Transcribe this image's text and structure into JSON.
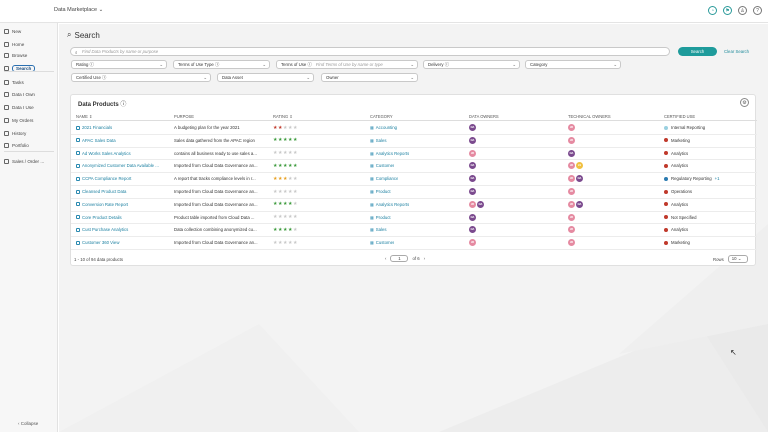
{
  "app": {
    "title": "Data Marketplace",
    "title_chevron": "⌄"
  },
  "topbar_icons": [
    {
      "name": "notification-icon",
      "glyph": "◔"
    },
    {
      "name": "flag-icon",
      "glyph": "⚑"
    },
    {
      "name": "user-icon",
      "glyph": "♙"
    },
    {
      "name": "help-icon",
      "glyph": "?"
    }
  ],
  "sidebar": {
    "items": [
      {
        "label": "New",
        "icon": "new-icon"
      },
      {
        "label": "Home",
        "icon": "home-icon"
      },
      {
        "label": "Browse",
        "icon": "browse-icon"
      },
      {
        "label": "Search",
        "icon": "search-icon",
        "active": true
      },
      {
        "label": "Tasks",
        "icon": "tasks-icon"
      },
      {
        "label": "Data I Own",
        "icon": "data-own-icon"
      },
      {
        "label": "Data I Use",
        "icon": "data-use-icon"
      },
      {
        "label": "My Orders",
        "icon": "orders-icon"
      },
      {
        "label": "History",
        "icon": "history-icon"
      },
      {
        "label": "Portfolio",
        "icon": "portfolio-icon"
      },
      {
        "label": "Sales / Order ...",
        "icon": "sales-icon"
      }
    ],
    "collapse_label": "Collapse"
  },
  "page": {
    "title": "Search"
  },
  "search": {
    "placeholder": "Find Data Products by name or purpose",
    "button_label": "Search",
    "clear_label": "Clear Search"
  },
  "filters": {
    "rating": "Rating",
    "terms_type": "Terms of Use Type",
    "terms_of_use": "Terms of Use",
    "terms_placeholder": "Find Terms of Use by name or type",
    "delivery": "Delivery",
    "category": "Category",
    "certified_use": "Certified Use",
    "data_asset": "Data Asset",
    "owner": "Owner"
  },
  "table": {
    "title": "Data Products",
    "columns": {
      "name": "NAME",
      "purpose": "PURPOSE",
      "rating": "RATING",
      "category": "CATEGORY",
      "data_owners": "DATA OWNERS",
      "technical_owners": "TECHNICAL OWNERS",
      "certified_use": "CERTIFIED USE"
    },
    "rows": [
      {
        "name": "2021 Financials",
        "purpose": "A budgeting plan for the year 2021",
        "rating": 2,
        "star_color": "#c0392b",
        "category": "Accounting",
        "owners": [
          {
            "i": "NA",
            "c": "#7b4a8e"
          }
        ],
        "tech": [
          {
            "i": "JR",
            "c": "#e58aa1"
          }
        ],
        "use": "Internal Reporting",
        "use_color": "#9ad0e0"
      },
      {
        "name": "APAC Sales Data",
        "purpose": "Sales data gathered from the APAC region",
        "rating": 5,
        "star_color": "#3c9a3c",
        "category": "Sales",
        "owners": [
          {
            "i": "NA",
            "c": "#7b4a8e"
          }
        ],
        "tech": [
          {
            "i": "JR",
            "c": "#e58aa1"
          }
        ],
        "use": "Marketing",
        "use_color": "#c0392b"
      },
      {
        "name": "Ad Works Sales Analytics",
        "purpose": "contains all business ready to use sales a...",
        "rating": 0,
        "star_color": "#c8c8c8",
        "category": "Analytics Reports",
        "owners": [
          {
            "i": "JR",
            "c": "#e58aa1"
          }
        ],
        "tech": [
          {
            "i": "NA",
            "c": "#7b4a8e"
          }
        ],
        "use": "Analytics",
        "use_color": "#c0392b"
      },
      {
        "name": "Anonymized Customer Data Available ...",
        "purpose": "Imported from Cloud Data Governance an...",
        "rating": 5,
        "star_color": "#3c9a3c",
        "category": "Customer",
        "owners": [
          {
            "i": "NA",
            "c": "#7b4a8e"
          }
        ],
        "tech": [
          {
            "i": "JR",
            "c": "#e58aa1"
          },
          {
            "i": "LS",
            "c": "#f0c040"
          }
        ],
        "use": "Analytics",
        "use_color": "#c0392b"
      },
      {
        "name": "CCPA Compliance Report",
        "purpose": "A report that tracks compliance levels in r...",
        "rating": 3,
        "star_color": "#e8a020",
        "category": "Compliance",
        "owners": [
          {
            "i": "NA",
            "c": "#7b4a8e"
          }
        ],
        "tech": [
          {
            "i": "JR",
            "c": "#e58aa1"
          },
          {
            "i": "NA",
            "c": "#7b4a8e"
          }
        ],
        "use": "Regulatory Reporting",
        "use_color": "#2a7ab0",
        "use_extra": "+1"
      },
      {
        "name": "Cleansed Product Data",
        "purpose": "Imported from Cloud Data Governance an...",
        "rating": 0,
        "star_color": "#c8c8c8",
        "category": "Product",
        "owners": [
          {
            "i": "NA",
            "c": "#7b4a8e"
          }
        ],
        "tech": [
          {
            "i": "JR",
            "c": "#e58aa1"
          }
        ],
        "use": "Operations",
        "use_color": "#c0392b"
      },
      {
        "name": "Conversion Rate Report",
        "purpose": "Imported from Cloud Data Governance an...",
        "rating": 4,
        "star_color": "#3c9a3c",
        "category": "Analytics Reports",
        "owners": [
          {
            "i": "JR",
            "c": "#e58aa1"
          },
          {
            "i": "NA",
            "c": "#7b4a8e"
          }
        ],
        "tech": [
          {
            "i": "JR",
            "c": "#e58aa1"
          },
          {
            "i": "NA",
            "c": "#7b4a8e"
          }
        ],
        "use": "Analytics",
        "use_color": "#c0392b"
      },
      {
        "name": "Core Product Details",
        "purpose": "Product table imported from Cloud Data ...",
        "rating": 0,
        "star_color": "#c8c8c8",
        "category": "Product",
        "owners": [
          {
            "i": "NA",
            "c": "#7b4a8e"
          }
        ],
        "tech": [
          {
            "i": "JR",
            "c": "#e58aa1"
          }
        ],
        "use": "Not Specified",
        "use_color": "#c0392b"
      },
      {
        "name": "Cust Purchase Analytics",
        "purpose": "Data collection combining anonymized cu...",
        "rating": 4,
        "star_color": "#3c9a3c",
        "category": "Sales",
        "owners": [
          {
            "i": "NA",
            "c": "#7b4a8e"
          }
        ],
        "tech": [
          {
            "i": "JR",
            "c": "#e58aa1"
          }
        ],
        "use": "Analytics",
        "use_color": "#c0392b"
      },
      {
        "name": "Customer 360 View",
        "purpose": "Imported from Cloud Data Governance an...",
        "rating": 0,
        "star_color": "#c8c8c8",
        "category": "Customer",
        "owners": [
          {
            "i": "JR",
            "c": "#e58aa1"
          }
        ],
        "tech": [
          {
            "i": "JR",
            "c": "#e58aa1"
          }
        ],
        "use": "Marketing",
        "use_color": "#c0392b"
      }
    ],
    "footer_count": "1 - 10 of 94 data products",
    "page_current": "1",
    "page_total": "of 6",
    "rows_label": "Rows",
    "rows_value": "10"
  }
}
